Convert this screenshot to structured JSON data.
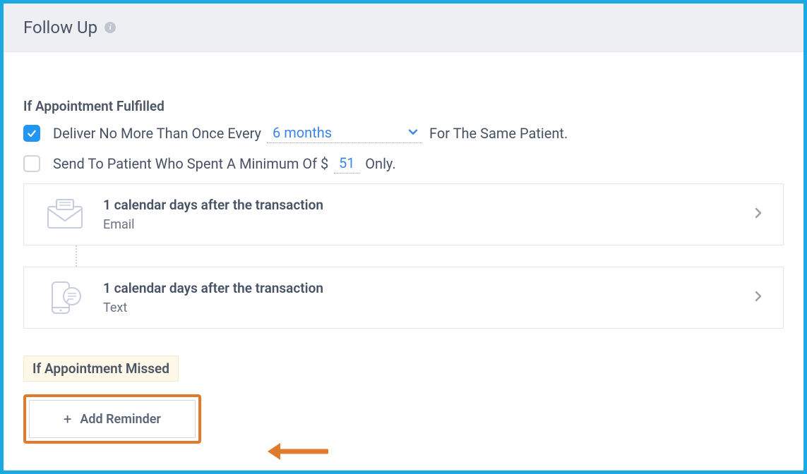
{
  "header": {
    "title": "Follow Up"
  },
  "fulfilled": {
    "label": "If Appointment Fulfilled",
    "deliver": {
      "prefix": "Deliver No More Than Once Every",
      "interval": "6 months",
      "suffix": "For The Same Patient."
    },
    "spend": {
      "prefix": "Send To Patient Who Spent A Minimum Of $",
      "amount": "51",
      "suffix": "Only."
    },
    "reminders": [
      {
        "title": "1 calendar days after the transaction",
        "type": "Email"
      },
      {
        "title": "1 calendar days after the transaction",
        "type": "Text"
      }
    ]
  },
  "missed": {
    "label": "If Appointment Missed"
  },
  "addReminder": {
    "label": "Add Reminder"
  }
}
